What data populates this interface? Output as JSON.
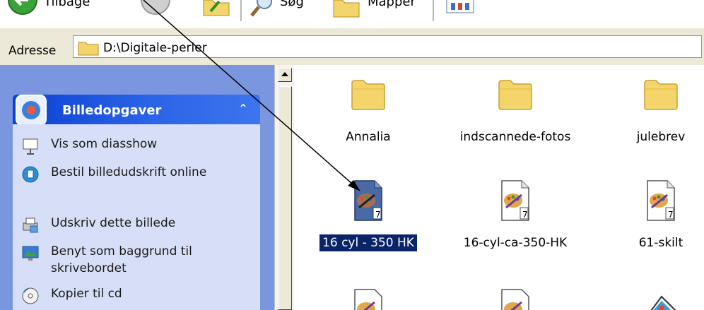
{
  "toolbar": {
    "back_label": "Tilbage",
    "search_label": "Søg",
    "folders_label": "Mapper"
  },
  "address": {
    "label": "Adresse",
    "value": "D:\\Digitale-perler"
  },
  "tasks_panel": {
    "title": "Billedopgaver",
    "items": [
      {
        "label": "Vis som diasshow",
        "icon": "slideshow-icon"
      },
      {
        "label": "Bestil billedudskrift online",
        "icon": "web-globe-icon"
      },
      {
        "label": "Udskriv dette billede",
        "icon": "printer-icon"
      },
      {
        "label": "Benyt som baggrund til skrivebordet",
        "icon": "desktop-background-icon"
      },
      {
        "label": "Kopier til cd",
        "icon": "cd-icon"
      }
    ]
  },
  "files": {
    "folders": [
      {
        "name": "Annalia"
      },
      {
        "name": "indscannede-fotos"
      },
      {
        "name": "julebrev"
      }
    ],
    "images": [
      {
        "name": "16 cyl - 350 HK",
        "selected": true
      },
      {
        "name": "16-cyl-ca-350-HK",
        "selected": false
      },
      {
        "name": "61-skilt",
        "selected": false
      }
    ]
  },
  "colors": {
    "selection": "#0a246a",
    "panel_header": "#0c41d4",
    "panel_body": "#d6dff7",
    "pane_background": "#7a96df",
    "folder": "#f3d56b"
  }
}
